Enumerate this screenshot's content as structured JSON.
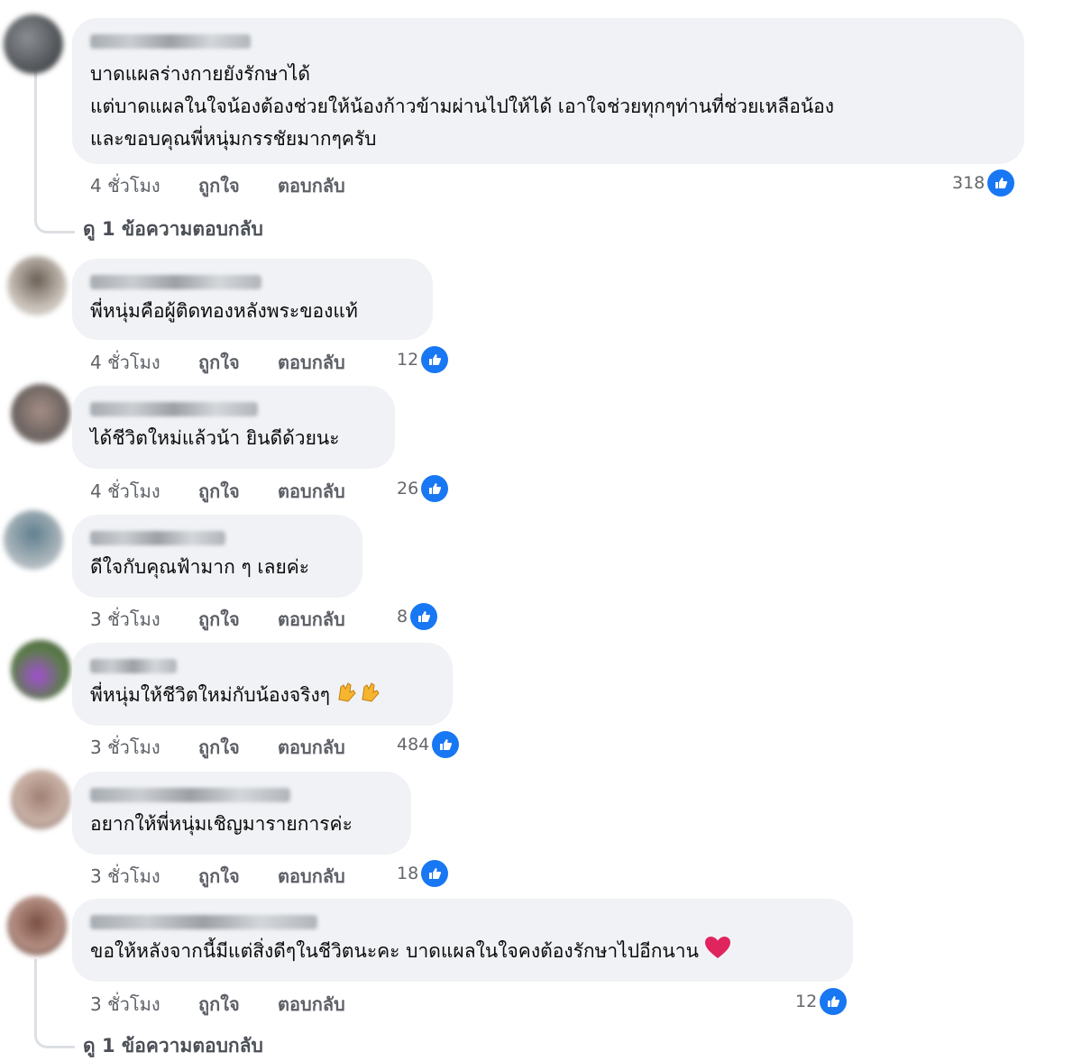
{
  "comments": [
    {
      "text": "บาดแผลร่างกายยังรักษาได้\nแต่บาดแผลในใจน้องต้องช่วยให้น้องก้าวข้ามผ่านไปให้ได้ เอาใจช่วยทุกๆท่านที่ช่วยเหลือน้อง\nและขอบคุณพี่หนุ่มกรรชัยมากๆครับ",
      "time": "4 ชั่วโมง",
      "like": "ถูกใจ",
      "reply": "ตอบกลับ",
      "reactions": "318",
      "view_replies": "ดู 1 ข้อความตอบกลับ"
    },
    {
      "text": "พี่หนุ่มคือผู้ติดทองหลังพระของแท้",
      "time": "4 ชั่วโมง",
      "like": "ถูกใจ",
      "reply": "ตอบกลับ",
      "reactions": "12"
    },
    {
      "text": "ได้ชีวิตใหม่แล้วน้า ยินดีด้วยนะ",
      "time": "4 ชั่วโมง",
      "like": "ถูกใจ",
      "reply": "ตอบกลับ",
      "reactions": "26"
    },
    {
      "text": "ดีใจกับคุณฟ้ามาก ๆ เลยค่ะ",
      "time": "3 ชั่วโมง",
      "like": "ถูกใจ",
      "reply": "ตอบกลับ",
      "reactions": "8"
    },
    {
      "text": "พี่หนุ่มให้ชีวิตใหม่กับน้องจริงๆ",
      "time": "3 ชั่วโมง",
      "like": "ถูกใจ",
      "reply": "ตอบกลับ",
      "reactions": "484"
    },
    {
      "text": "อยากให้พี่หนุ่มเชิญมารายการค่ะ",
      "time": "3 ชั่วโมง",
      "like": "ถูกใจ",
      "reply": "ตอบกลับ",
      "reactions": "18"
    },
    {
      "text": "ขอให้หลังจากนี้มีแต่สิ่งดีๆในชีวิตนะคะ บาดแผลในใจคงต้องรักษาไปอีกนาน",
      "time": "3 ชั่วโมง",
      "like": "ถูกใจ",
      "reply": "ตอบกลับ",
      "reactions": "12",
      "view_replies": "ดู 1 ข้อความตอบกลับ"
    }
  ],
  "colors": {
    "like_blue": "#1877f2",
    "bubble_bg": "#f0f2f5",
    "heart": "#e0245e"
  },
  "icons": {
    "like": "thumbs-up-icon",
    "clap": "clapping-hands-emoji",
    "heart": "red-heart-emoji"
  }
}
